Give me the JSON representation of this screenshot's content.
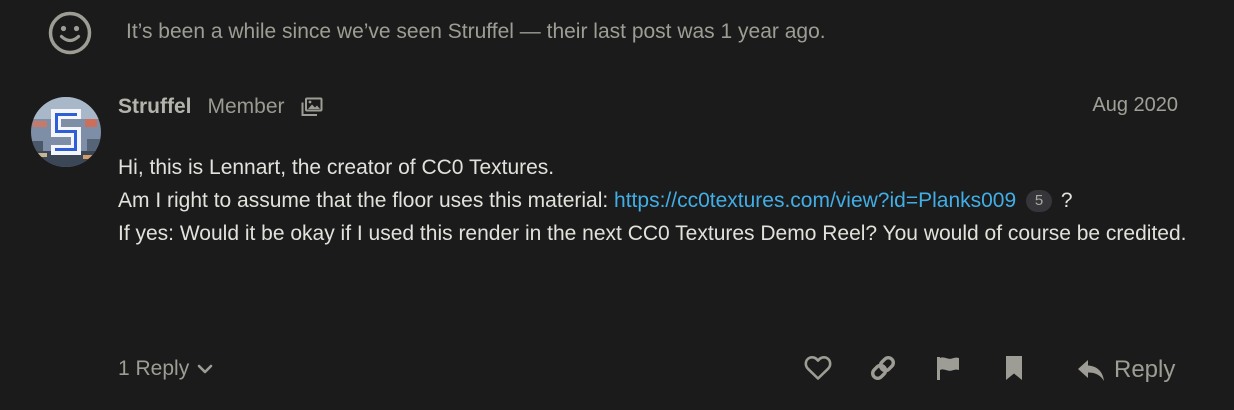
{
  "notice": {
    "icon": "smile-icon",
    "text": "It’s been a while since we’ve seen Struffel — their last post was 1 year ago."
  },
  "post": {
    "avatar_letter": "S",
    "username": "Struffel",
    "user_title": "Member",
    "flair_icon": "images-icon",
    "date": "Aug 2020",
    "body": {
      "line1": "Hi, this is Lennart, the creator of CC0 Textures.",
      "line2_prefix": "Am I right to assume that the floor uses this material: ",
      "link_text": "https://cc0textures.com/view?id=Planks009",
      "link_clicks": "5",
      "line2_suffix": " ?",
      "line3": "If yes: Would it be okay if I used this render in the next CC0 Textures Demo Reel? You would of course be credited."
    }
  },
  "footer": {
    "replies_label": "1 Reply",
    "actions": [
      "heart-icon",
      "link-icon",
      "flag-icon",
      "bookmark-icon"
    ],
    "reply_label": "Reply"
  },
  "colors": {
    "background": "#1b1b1b",
    "text": "#e2e2dc",
    "muted": "#9d9d95",
    "link": "#41aee6"
  }
}
